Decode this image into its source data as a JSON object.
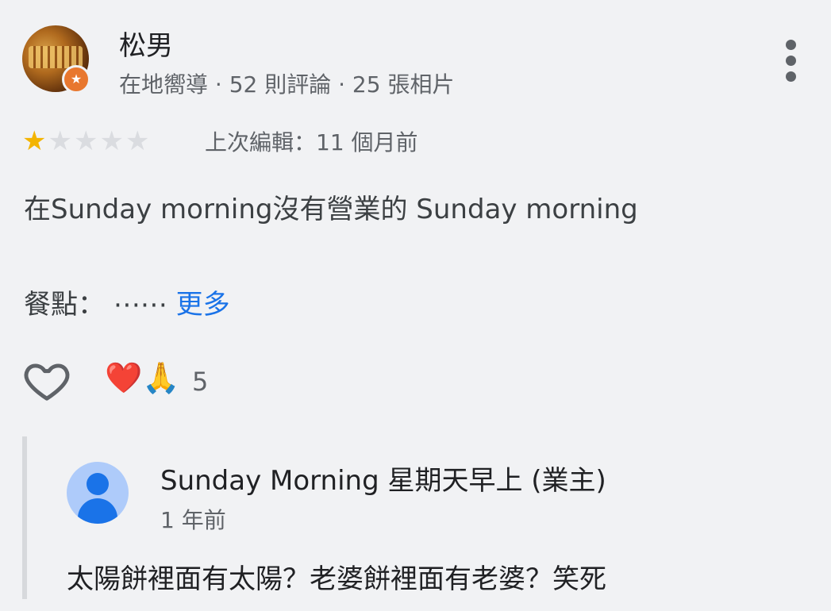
{
  "reviewer": {
    "name": "松男",
    "meta": "在地嚮導 · 52 則評論 · 25 張相片"
  },
  "rating": {
    "value": 1,
    "max": 5,
    "stars": [
      "★",
      "★",
      "★",
      "★",
      "★"
    ],
    "edited": "上次編輯：11 個月前"
  },
  "review": {
    "text": "在Sunday morning沒有營業的 Sunday morning",
    "meal_label": "餐點：",
    "meal_value": " ⋯⋯ ",
    "more_link": "更多"
  },
  "reactions": {
    "emojis": "❤️🙏",
    "count": "5"
  },
  "owner_reply": {
    "name": "Sunday Morning 星期天早上 (業主)",
    "time": "1 年前",
    "text": "太陽餅裡面有太陽？老婆餅裡面有老婆？笑死"
  },
  "colors": {
    "background": "#f1f2f4",
    "star_active": "#f3b400",
    "star_inactive": "#dadce0",
    "link": "#1a73e8",
    "owner_avatar_bg": "#aecbfa"
  },
  "icons": {
    "overflow_menu": "vertical-dots-icon",
    "like": "heart-outline-icon",
    "badge": "local-guide-star-icon"
  }
}
